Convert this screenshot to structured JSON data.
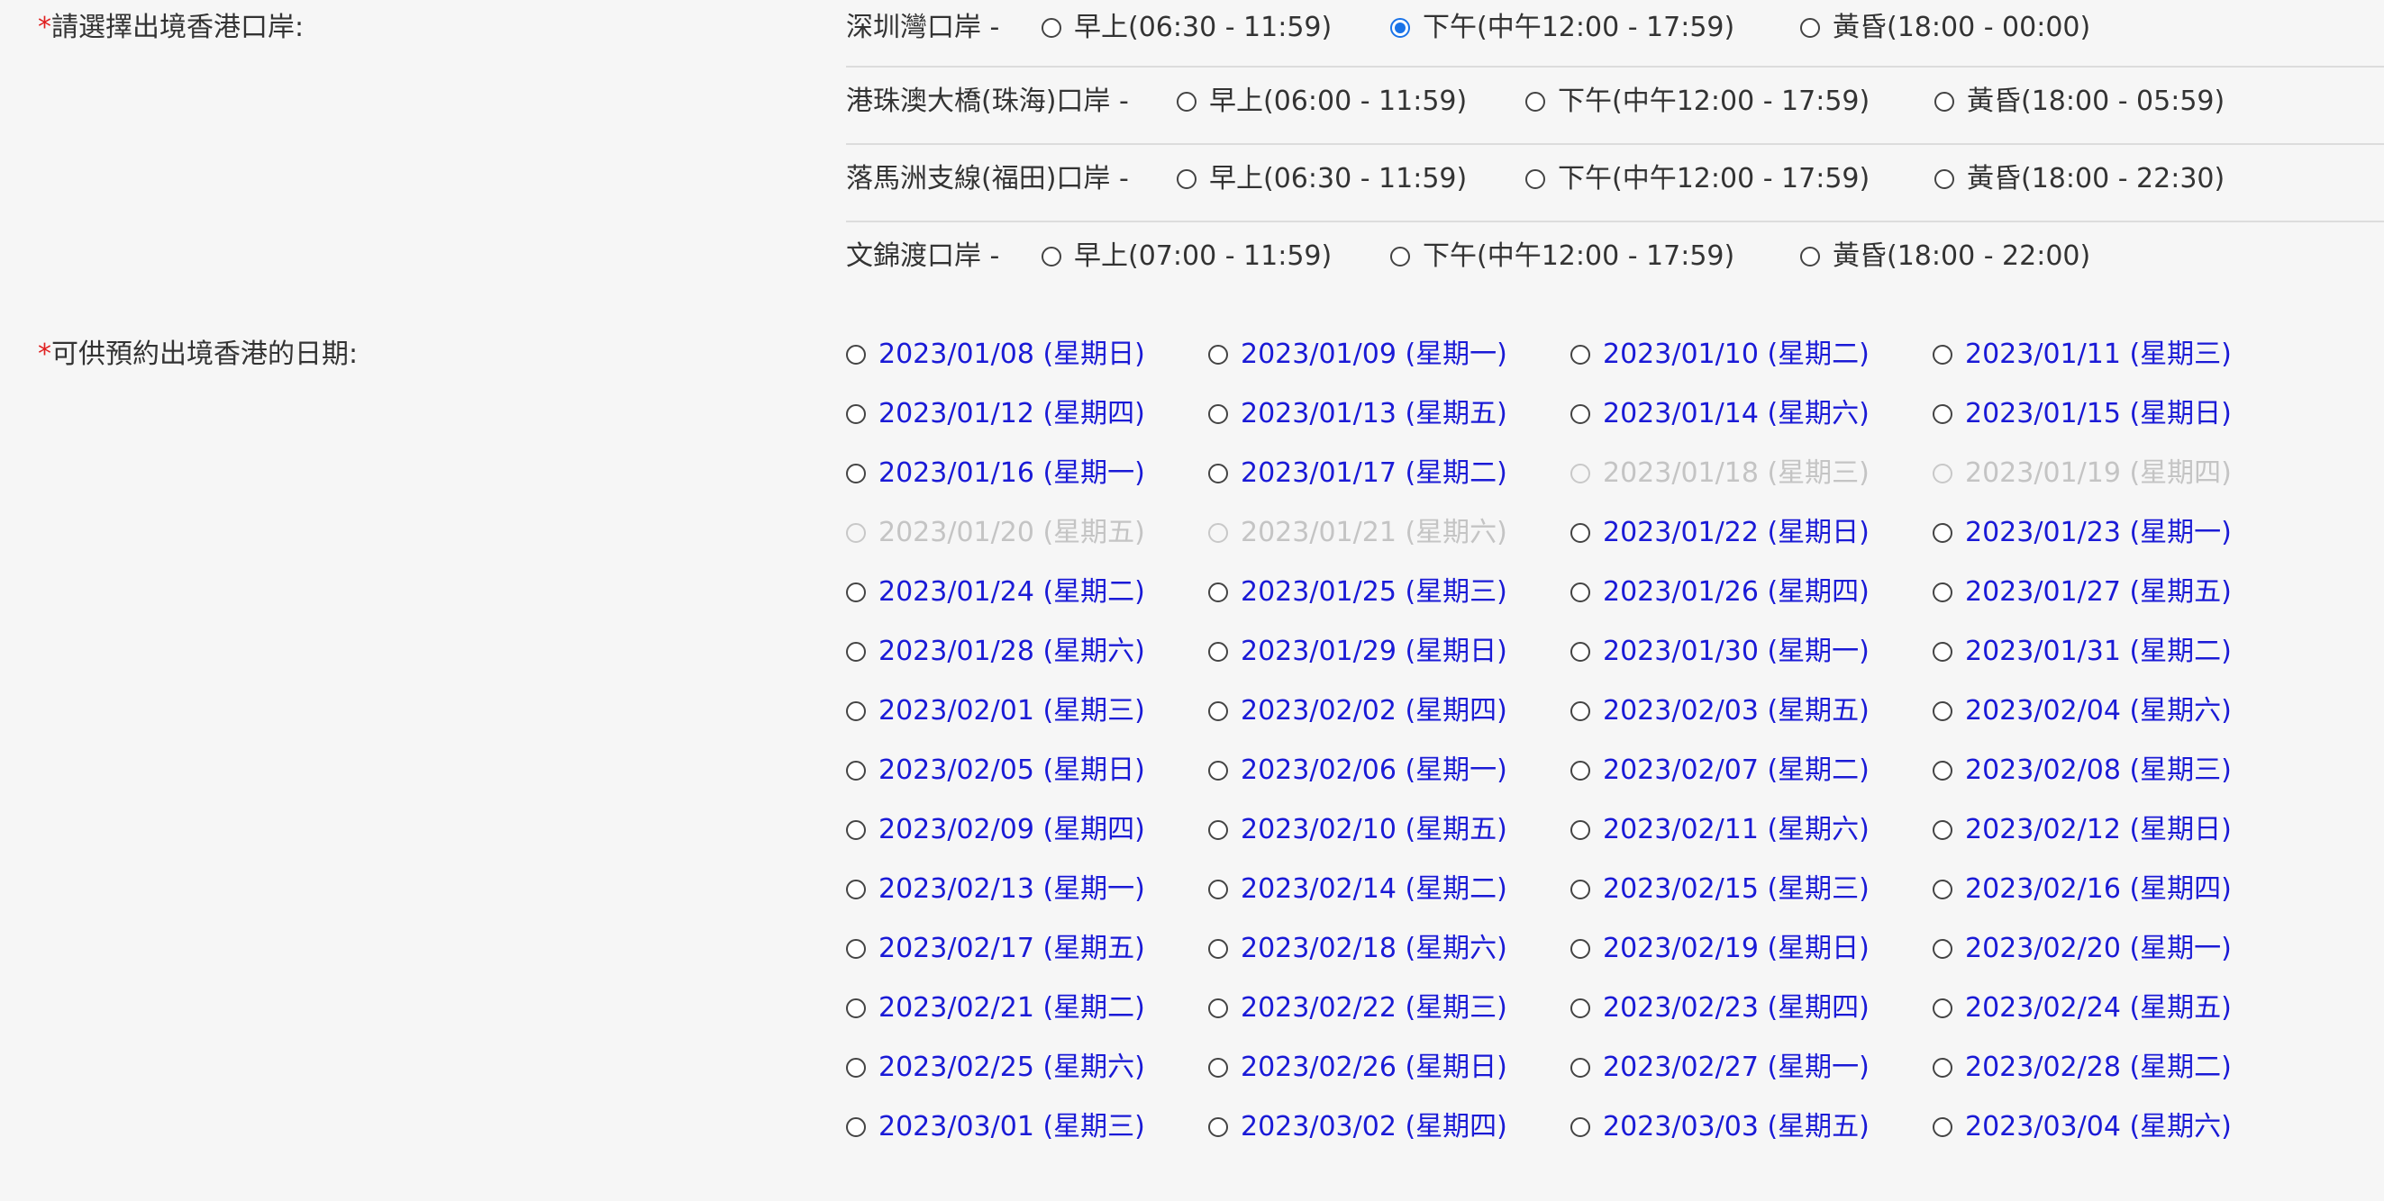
{
  "port_label": {
    "required_mark": "*",
    "text": "請選擇出境香港口岸:"
  },
  "date_label": {
    "required_mark": "*",
    "text": "可供預約出境香港的日期:"
  },
  "ports": [
    {
      "name": "深圳灣口岸 -",
      "options": [
        {
          "label": "早上(06:30 - 11:59)",
          "checked": false
        },
        {
          "label": "下午(中午12:00 - 17:59)",
          "checked": true
        },
        {
          "label": "黃昏(18:00 - 00:00)",
          "checked": false
        }
      ]
    },
    {
      "name": "港珠澳大橋(珠海)口岸 -",
      "options": [
        {
          "label": "早上(06:00 - 11:59)",
          "checked": false
        },
        {
          "label": "下午(中午12:00 - 17:59)",
          "checked": false
        },
        {
          "label": "黃昏(18:00 - 05:59)",
          "checked": false
        }
      ]
    },
    {
      "name": "落馬洲支線(福田)口岸 -",
      "options": [
        {
          "label": "早上(06:30 - 11:59)",
          "checked": false
        },
        {
          "label": "下午(中午12:00 - 17:59)",
          "checked": false
        },
        {
          "label": "黃昏(18:00 - 22:30)",
          "checked": false
        }
      ]
    },
    {
      "name": "文錦渡口岸 -",
      "options": [
        {
          "label": "早上(07:00 - 11:59)",
          "checked": false
        },
        {
          "label": "下午(中午12:00 - 17:59)",
          "checked": false
        },
        {
          "label": "黃昏(18:00 - 22:00)",
          "checked": false
        }
      ]
    }
  ],
  "dates": [
    {
      "label": "2023/01/08 (星期日)",
      "disabled": false
    },
    {
      "label": "2023/01/09 (星期一)",
      "disabled": false
    },
    {
      "label": "2023/01/10 (星期二)",
      "disabled": false
    },
    {
      "label": "2023/01/11 (星期三)",
      "disabled": false
    },
    {
      "label": "2023/01/12 (星期四)",
      "disabled": false
    },
    {
      "label": "2023/01/13 (星期五)",
      "disabled": false
    },
    {
      "label": "2023/01/14 (星期六)",
      "disabled": false
    },
    {
      "label": "2023/01/15 (星期日)",
      "disabled": false
    },
    {
      "label": "2023/01/16 (星期一)",
      "disabled": false
    },
    {
      "label": "2023/01/17 (星期二)",
      "disabled": false
    },
    {
      "label": "2023/01/18 (星期三)",
      "disabled": true
    },
    {
      "label": "2023/01/19 (星期四)",
      "disabled": true
    },
    {
      "label": "2023/01/20 (星期五)",
      "disabled": true
    },
    {
      "label": "2023/01/21 (星期六)",
      "disabled": true
    },
    {
      "label": "2023/01/22 (星期日)",
      "disabled": false
    },
    {
      "label": "2023/01/23 (星期一)",
      "disabled": false
    },
    {
      "label": "2023/01/24 (星期二)",
      "disabled": false
    },
    {
      "label": "2023/01/25 (星期三)",
      "disabled": false
    },
    {
      "label": "2023/01/26 (星期四)",
      "disabled": false
    },
    {
      "label": "2023/01/27 (星期五)",
      "disabled": false
    },
    {
      "label": "2023/01/28 (星期六)",
      "disabled": false
    },
    {
      "label": "2023/01/29 (星期日)",
      "disabled": false
    },
    {
      "label": "2023/01/30 (星期一)",
      "disabled": false
    },
    {
      "label": "2023/01/31 (星期二)",
      "disabled": false
    },
    {
      "label": "2023/02/01 (星期三)",
      "disabled": false
    },
    {
      "label": "2023/02/02 (星期四)",
      "disabled": false
    },
    {
      "label": "2023/02/03 (星期五)",
      "disabled": false
    },
    {
      "label": "2023/02/04 (星期六)",
      "disabled": false
    },
    {
      "label": "2023/02/05 (星期日)",
      "disabled": false
    },
    {
      "label": "2023/02/06 (星期一)",
      "disabled": false
    },
    {
      "label": "2023/02/07 (星期二)",
      "disabled": false
    },
    {
      "label": "2023/02/08 (星期三)",
      "disabled": false
    },
    {
      "label": "2023/02/09 (星期四)",
      "disabled": false
    },
    {
      "label": "2023/02/10 (星期五)",
      "disabled": false
    },
    {
      "label": "2023/02/11 (星期六)",
      "disabled": false
    },
    {
      "label": "2023/02/12 (星期日)",
      "disabled": false
    },
    {
      "label": "2023/02/13 (星期一)",
      "disabled": false
    },
    {
      "label": "2023/02/14 (星期二)",
      "disabled": false
    },
    {
      "label": "2023/02/15 (星期三)",
      "disabled": false
    },
    {
      "label": "2023/02/16 (星期四)",
      "disabled": false
    },
    {
      "label": "2023/02/17 (星期五)",
      "disabled": false
    },
    {
      "label": "2023/02/18 (星期六)",
      "disabled": false
    },
    {
      "label": "2023/02/19 (星期日)",
      "disabled": false
    },
    {
      "label": "2023/02/20 (星期一)",
      "disabled": false
    },
    {
      "label": "2023/02/21 (星期二)",
      "disabled": false
    },
    {
      "label": "2023/02/22 (星期三)",
      "disabled": false
    },
    {
      "label": "2023/02/23 (星期四)",
      "disabled": false
    },
    {
      "label": "2023/02/24 (星期五)",
      "disabled": false
    },
    {
      "label": "2023/02/25 (星期六)",
      "disabled": false
    },
    {
      "label": "2023/02/26 (星期日)",
      "disabled": false
    },
    {
      "label": "2023/02/27 (星期一)",
      "disabled": false
    },
    {
      "label": "2023/02/28 (星期二)",
      "disabled": false
    },
    {
      "label": "2023/03/01 (星期三)",
      "disabled": false
    },
    {
      "label": "2023/03/02 (星期四)",
      "disabled": false
    },
    {
      "label": "2023/03/03 (星期五)",
      "disabled": false
    },
    {
      "label": "2023/03/04 (星期六)",
      "disabled": false
    }
  ],
  "colors": {
    "background": "#f6f6f6",
    "text": "#333333",
    "link": "#1a1ad6",
    "disabled": "#c4c4c4",
    "required": "#e02020",
    "selected": "#1a73e8",
    "divider": "#dcdcdc"
  }
}
